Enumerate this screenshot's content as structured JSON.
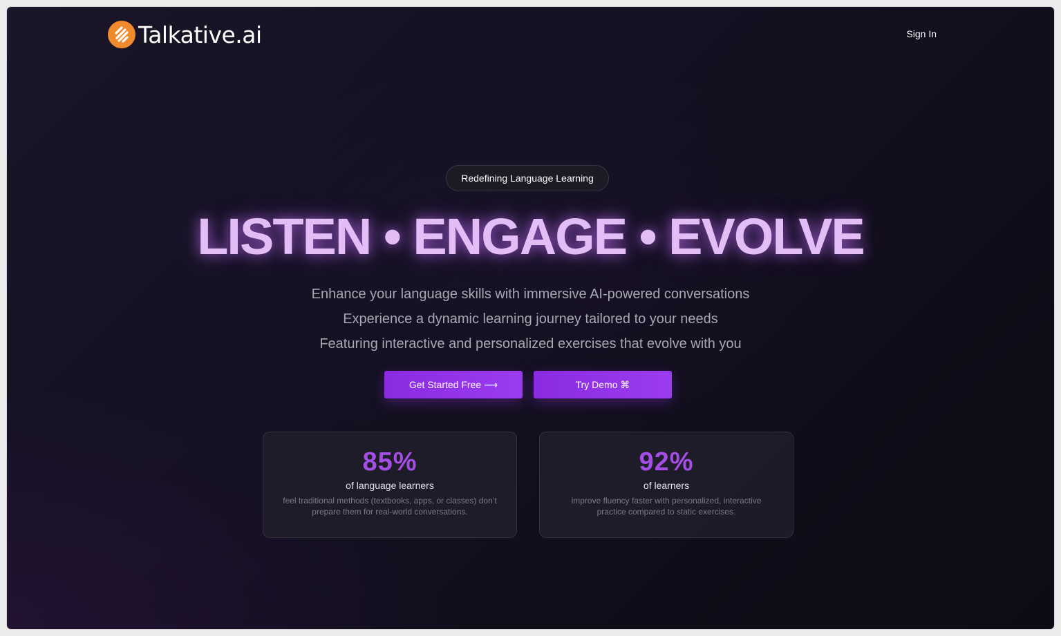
{
  "header": {
    "brand": "Talkative.ai",
    "sign_in": "Sign In"
  },
  "hero": {
    "badge": "Redefining Language Learning",
    "headline": "LISTEN • ENGAGE • EVOLVE",
    "subtitle_lines": [
      "Enhance your language skills with immersive AI-powered conversations",
      "Experience a dynamic learning journey tailored to your needs",
      "Featuring interactive and personalized exercises that evolve with you"
    ],
    "primary_button": "Get Started Free ⟶",
    "secondary_button": "Try Demo ⌘"
  },
  "stats": [
    {
      "value": "85%",
      "label": "of language learners",
      "description": "feel traditional methods (textbooks, apps, or classes) don’t prepare them for real-world conversations."
    },
    {
      "value": "92%",
      "label": "of learners",
      "description": "improve fluency faster with personalized, interactive practice compared to static exercises."
    }
  ],
  "colors": {
    "accent": "#8a2be2",
    "headline": "#e2bdf6",
    "stat": "#a54ee6",
    "logo": "#f08a2c"
  },
  "icons": {
    "logo": "talkative-logo-icon"
  }
}
